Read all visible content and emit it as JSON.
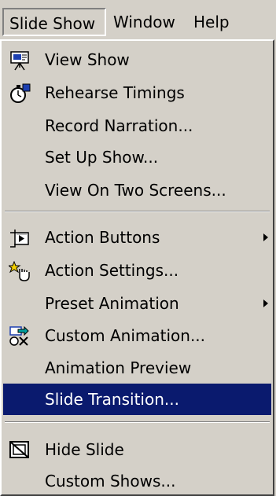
{
  "menubar": {
    "items": [
      {
        "label": "Slide Show",
        "active": true
      },
      {
        "label": "Window",
        "active": false
      },
      {
        "label": "Help",
        "active": false
      }
    ]
  },
  "menu": {
    "items": [
      {
        "label": "View Show",
        "icon": "projector-icon"
      },
      {
        "label": "Rehearse Timings",
        "icon": "stopwatch-icon"
      },
      {
        "label": "Record Narration...",
        "icon": ""
      },
      {
        "label": "Set Up Show...",
        "icon": ""
      },
      {
        "label": "View On Two Screens...",
        "icon": ""
      },
      {
        "label": "Action Buttons",
        "icon": "action-buttons-icon",
        "submenu": true
      },
      {
        "label": "Action Settings...",
        "icon": "action-settings-icon"
      },
      {
        "label": "Preset Animation",
        "icon": "",
        "submenu": true
      },
      {
        "label": "Custom Animation...",
        "icon": "custom-animation-icon"
      },
      {
        "label": "Animation Preview",
        "icon": ""
      },
      {
        "label": "Slide Transition...",
        "icon": "",
        "selected": true
      },
      {
        "label": "Hide Slide",
        "icon": "hide-slide-icon"
      },
      {
        "label": "Custom Shows...",
        "icon": ""
      }
    ]
  },
  "colors": {
    "menu_background": "#d4d0c8",
    "highlight": "#0a1a6e",
    "highlight_text": "#ffffff"
  }
}
